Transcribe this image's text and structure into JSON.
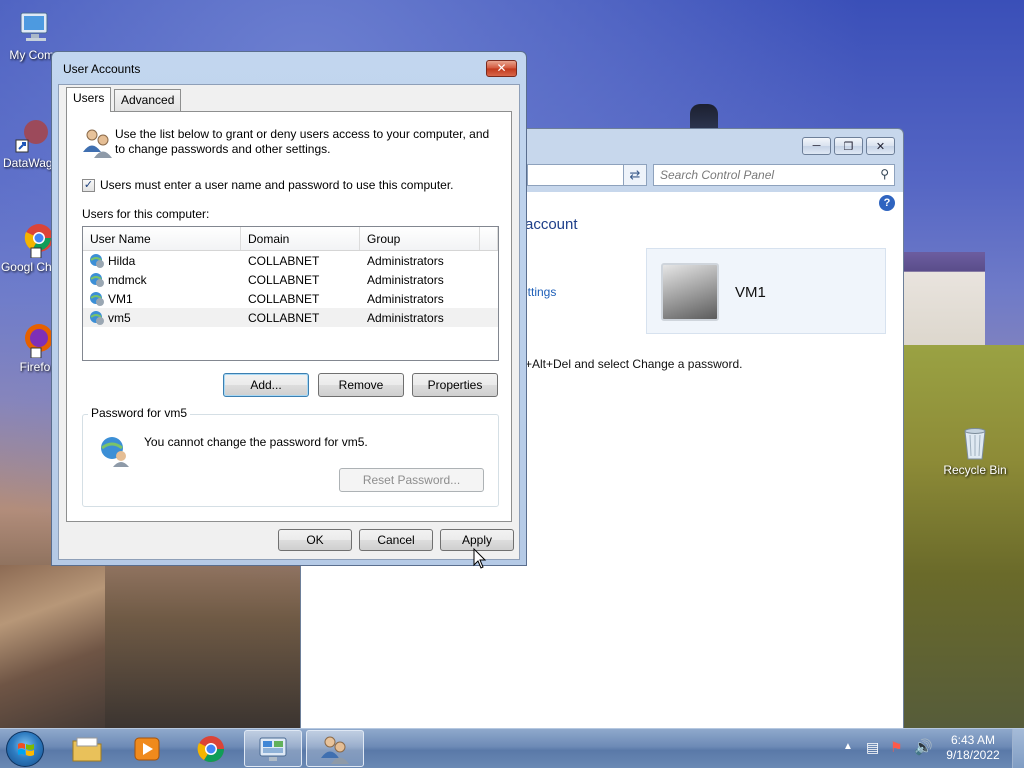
{
  "desktop": {
    "icons": [
      {
        "label": "My Comp",
        "name": "my-computer"
      },
      {
        "label": "DataWag",
        "name": "datawag"
      },
      {
        "label": "Googl Chron",
        "name": "google-chrome"
      },
      {
        "label": "Firefo",
        "name": "firefox"
      },
      {
        "label": "Recycle Bin",
        "name": "recycle-bin"
      }
    ]
  },
  "control_panel": {
    "search_placeholder": "Search Control Panel",
    "heading": "account",
    "link": "ettings",
    "text": "+Alt+Del and select Change a password.",
    "user_name": "VM1"
  },
  "dialog": {
    "title": "User Accounts",
    "tabs": [
      "Users",
      "Advanced"
    ],
    "intro": "Use the list below to grant or deny users access to your computer, and to change passwords and other settings.",
    "require_login_label": "Users must enter a user name and password to use this computer.",
    "require_login_checked": true,
    "users_label": "Users for this computer:",
    "columns": [
      "User Name",
      "Domain",
      "Group"
    ],
    "users": [
      {
        "name": "Hilda",
        "domain": "COLLABNET",
        "group": "Administrators"
      },
      {
        "name": "mdmck",
        "domain": "COLLABNET",
        "group": "Administrators"
      },
      {
        "name": "VM1",
        "domain": "COLLABNET",
        "group": "Administrators"
      },
      {
        "name": "vm5",
        "domain": "COLLABNET",
        "group": "Administrators"
      }
    ],
    "selected_user": "vm5",
    "buttons": {
      "add": "Add...",
      "remove": "Remove",
      "properties": "Properties"
    },
    "password_group_label": "Password for vm5",
    "password_message": "You cannot change the password for vm5.",
    "reset_password": "Reset Password...",
    "ok": "OK",
    "cancel": "Cancel",
    "apply": "Apply"
  },
  "taskbar": {
    "time": "6:43 AM",
    "date": "9/18/2022"
  }
}
